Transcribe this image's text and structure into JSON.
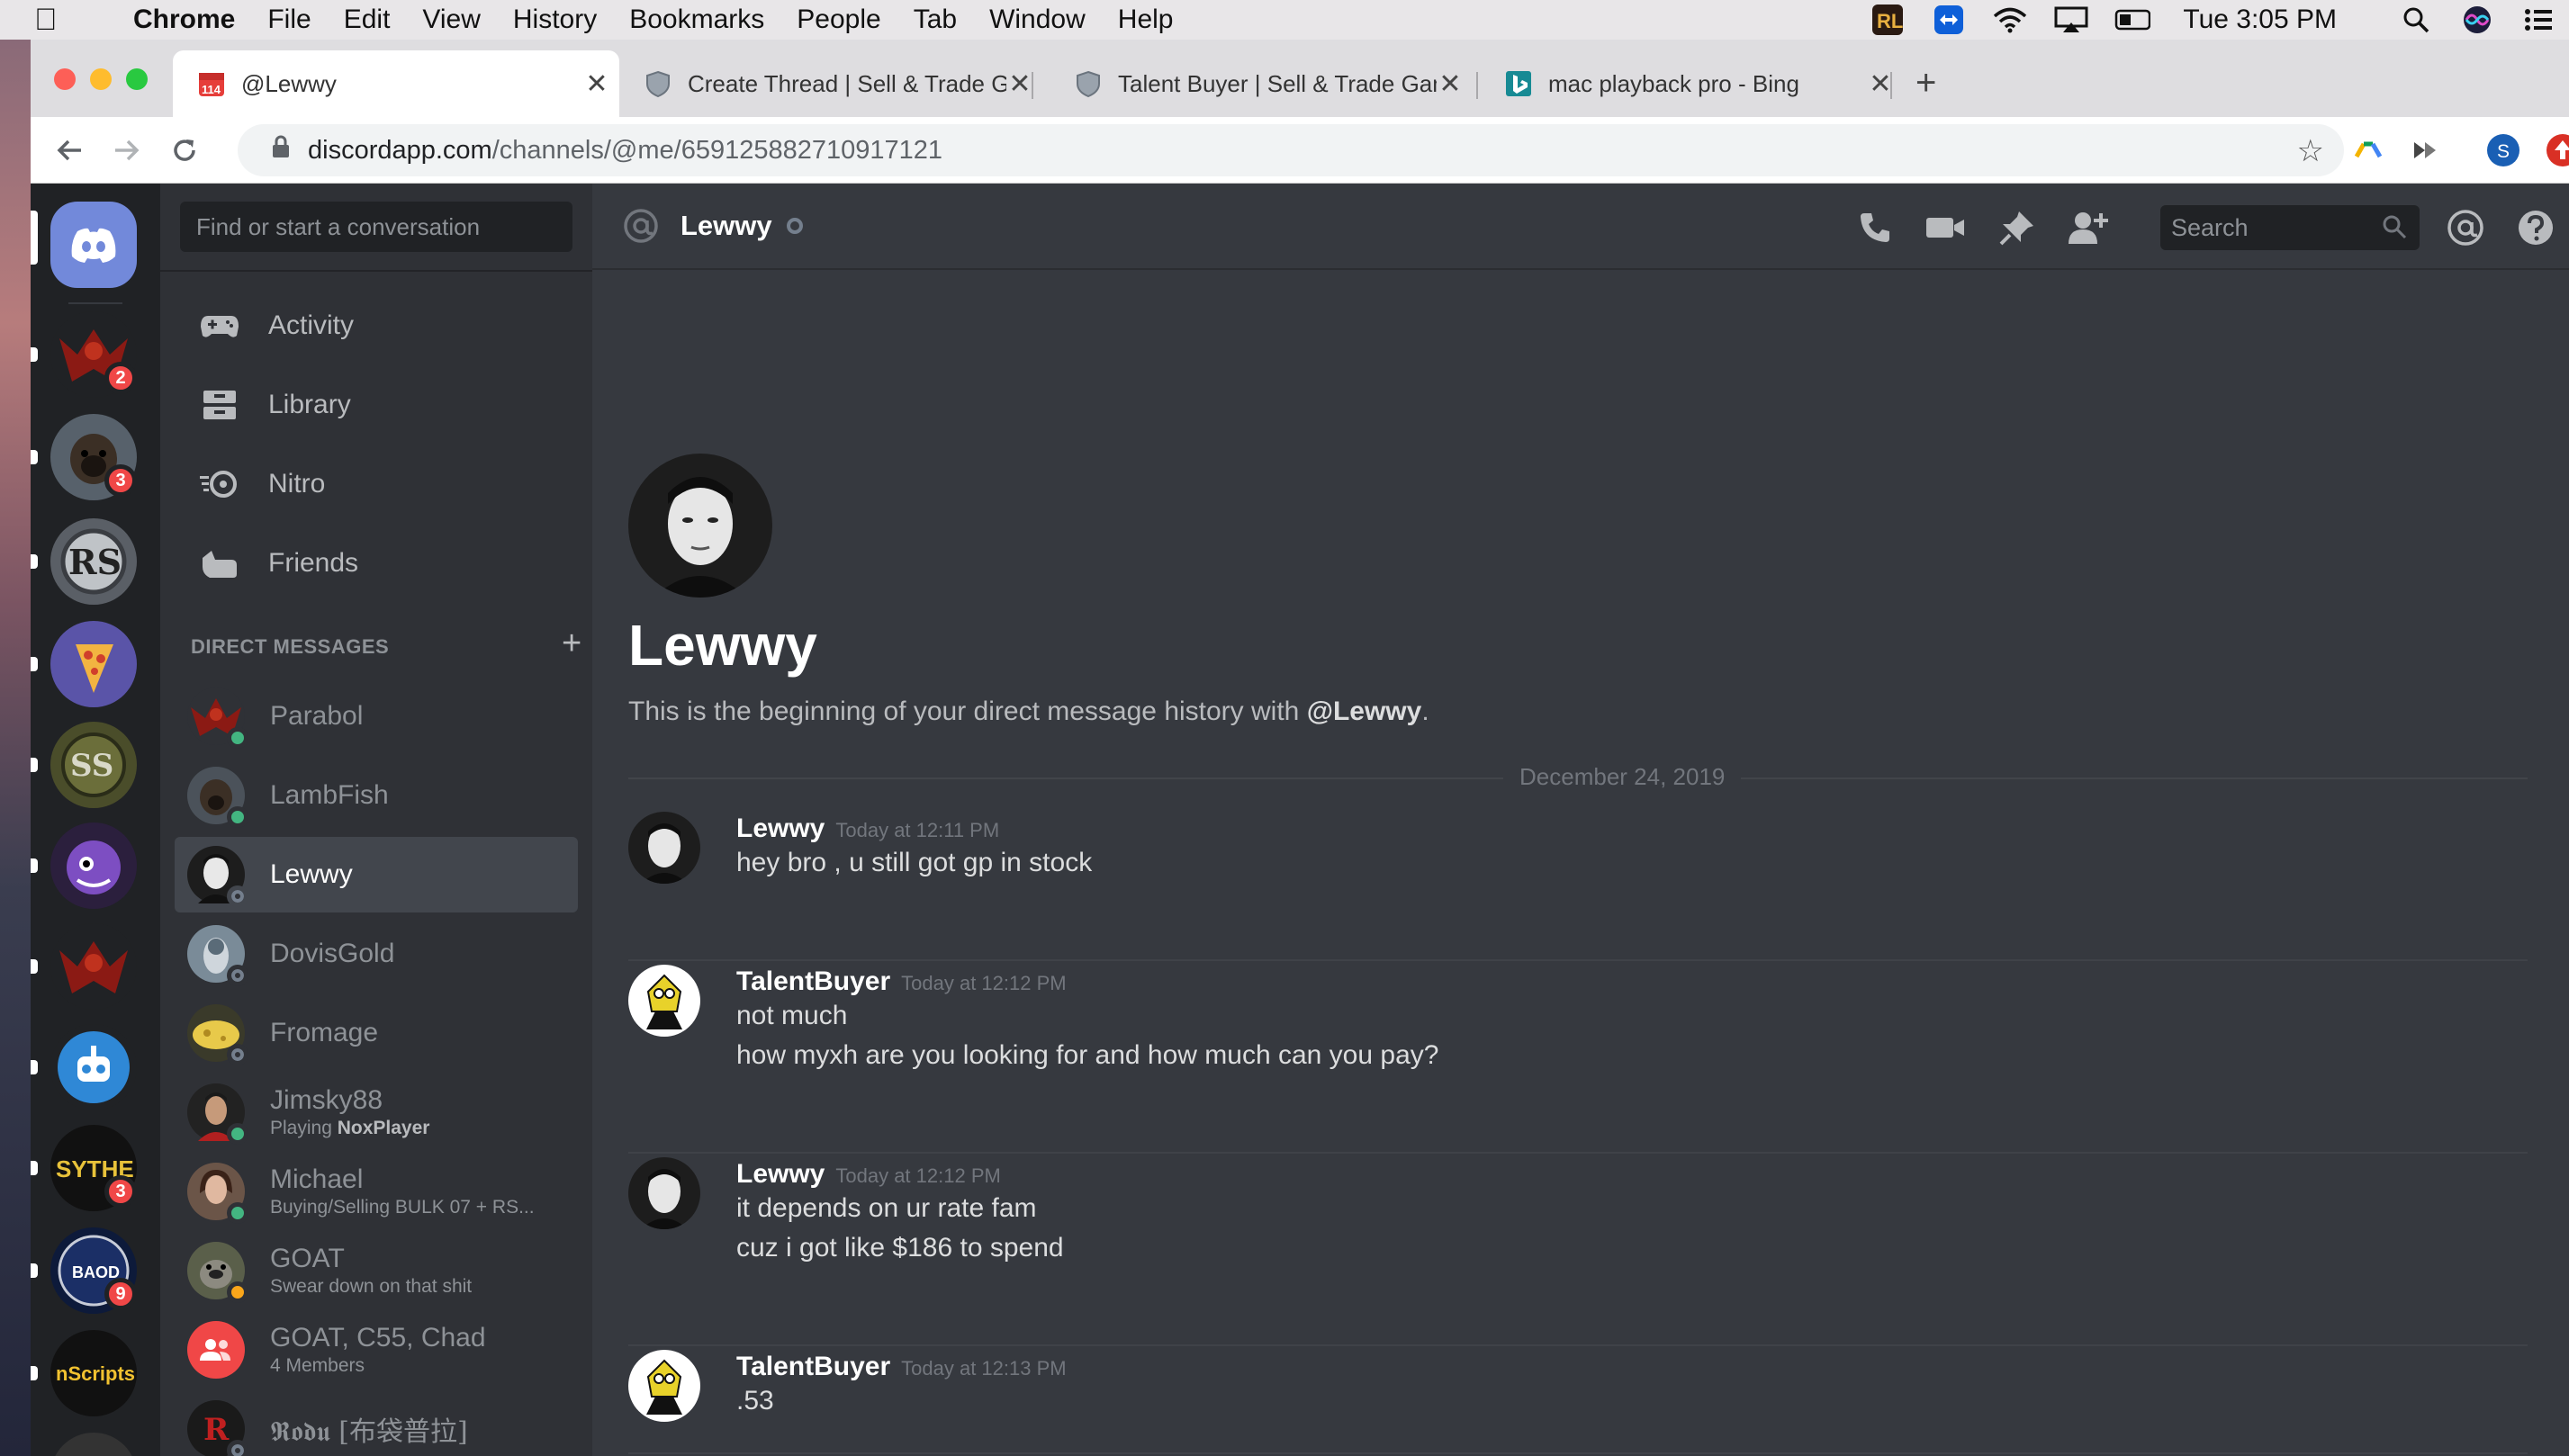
{
  "menubar": {
    "app": "Chrome",
    "items": [
      "File",
      "Edit",
      "View",
      "History",
      "Bookmarks",
      "People",
      "Tab",
      "Window",
      "Help"
    ],
    "clock": "Tue 3:05 PM"
  },
  "browser": {
    "tabs": [
      {
        "title": "@Lewwy",
        "favicon": "discord-calendar-icon",
        "badge": "114"
      },
      {
        "title": "Create Thread | Sell & Trade Ga",
        "favicon": "shield-icon"
      },
      {
        "title": "Talent Buyer | Sell & Trade Gam",
        "favicon": "shield-icon"
      },
      {
        "title": "mac playback pro - Bing",
        "favicon": "bing-icon"
      }
    ],
    "url_host": "discordapp.com",
    "url_path": "/channels/@me/659125882710917121",
    "profile_initial": "S"
  },
  "discord": {
    "guild_badges": [
      "2",
      "3",
      "3",
      "9"
    ],
    "guild_labels": {
      "sythe": "SYTHE",
      "baod": "BAOD",
      "nscripts": "nScripts",
      "rs": "RS",
      "ss": "SS"
    },
    "search_placeholder": "Find or start a conversation",
    "nav": [
      "Activity",
      "Library",
      "Nitro",
      "Friends"
    ],
    "dm_header": "DIRECT MESSAGES",
    "dms": [
      {
        "name": "Parabol",
        "sub": "",
        "status": "online"
      },
      {
        "name": "LambFish",
        "sub": "",
        "status": "online"
      },
      {
        "name": "Lewwy",
        "sub": "",
        "status": "offline"
      },
      {
        "name": "DovisGold",
        "sub": "",
        "status": "offline"
      },
      {
        "name": "Fromage",
        "sub": "",
        "status": "offline"
      },
      {
        "name": "Jimsky88",
        "sub_prefix": "Playing ",
        "sub_bold": "NoxPlayer",
        "status": "online"
      },
      {
        "name": "Michael",
        "sub": "Buying/Selling BULK 07 + RS...",
        "status": "online"
      },
      {
        "name": "GOAT",
        "sub": "Swear down on that shit",
        "status": "idle"
      },
      {
        "name": "GOAT, C55, Chad",
        "sub": "4 Members",
        "status": ""
      },
      {
        "name": "𝕽𝖔𝖉𝖚 [布袋普拉]",
        "sub": "",
        "status": "offline"
      }
    ],
    "channel": {
      "name": "Lewwy",
      "search_placeholder": "Search",
      "welcome_title": "Lewwy",
      "welcome_prefix": "This is the beginning of your direct message history with ",
      "welcome_user": "@Lewwy",
      "welcome_suffix": ".",
      "date_divider": "December 24, 2019"
    },
    "messages": [
      {
        "author": "Lewwy",
        "time": "Today at 12:11 PM",
        "lines": [
          "hey bro , u still got gp in stock"
        ]
      },
      {
        "author": "TalentBuyer",
        "time": "Today at 12:12 PM",
        "lines": [
          "not much",
          "how myxh are you looking for and how much can you pay?"
        ]
      },
      {
        "author": "Lewwy",
        "time": "Today at 12:12 PM",
        "lines": [
          "it depends on ur rate fam",
          "cuz i got like $186 to spend"
        ]
      },
      {
        "author": "TalentBuyer",
        "time": "Today at 12:13 PM",
        "lines": [
          ".53"
        ]
      }
    ]
  },
  "colors": {
    "discord_blurple": "#7289da",
    "online": "#43b581",
    "idle": "#faa61a",
    "offline": "#747f8d",
    "badge_red": "#f04747"
  }
}
